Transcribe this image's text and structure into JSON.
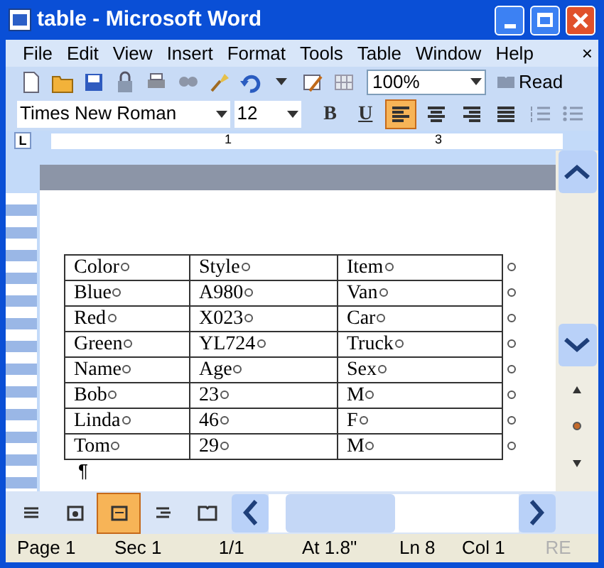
{
  "window": {
    "title": "table - Microsoft Word"
  },
  "menu": {
    "items": [
      "File",
      "Edit",
      "View",
      "Insert",
      "Format",
      "Tools",
      "Table",
      "Window",
      "Help"
    ],
    "close": "×"
  },
  "standard_toolbar": {
    "zoom": "100%",
    "read": "Read"
  },
  "formatting_toolbar": {
    "font": "Times New Roman",
    "size": "12",
    "bold": "B",
    "underline": "U",
    "align_buttons": [
      {
        "selected": true
      },
      {
        "selected": false
      },
      {
        "selected": false
      },
      {
        "selected": false
      }
    ]
  },
  "ruler": {
    "tab_selector": "L",
    "labels": [
      "1",
      "3"
    ]
  },
  "table": {
    "rows": [
      [
        "Color",
        "Style",
        "Item"
      ],
      [
        "Blue",
        "A980",
        "Van"
      ],
      [
        "Red",
        "X023",
        "Car"
      ],
      [
        "Green",
        "YL724",
        "Truck"
      ],
      [
        "Name",
        "Age",
        "Sex"
      ],
      [
        "Bob",
        "23",
        "M"
      ],
      [
        "Linda",
        "46",
        "F"
      ],
      [
        "Tom",
        "29",
        "M"
      ]
    ]
  },
  "paragraph_mark": "¶",
  "view_buttons": [
    {
      "selected": false
    },
    {
      "selected": false
    },
    {
      "selected": true
    },
    {
      "selected": false
    },
    {
      "selected": false
    }
  ],
  "status_bar": [
    {
      "text": "Page 1",
      "disabled": false
    },
    {
      "text": "Sec 1",
      "disabled": false
    },
    {
      "text": "1/1",
      "disabled": false
    },
    {
      "text": "At 1.8\"",
      "disabled": false
    },
    {
      "text": "Ln 8",
      "disabled": false
    },
    {
      "text": "Col 1",
      "disabled": false
    },
    {
      "text": "RE",
      "disabled": true
    }
  ]
}
